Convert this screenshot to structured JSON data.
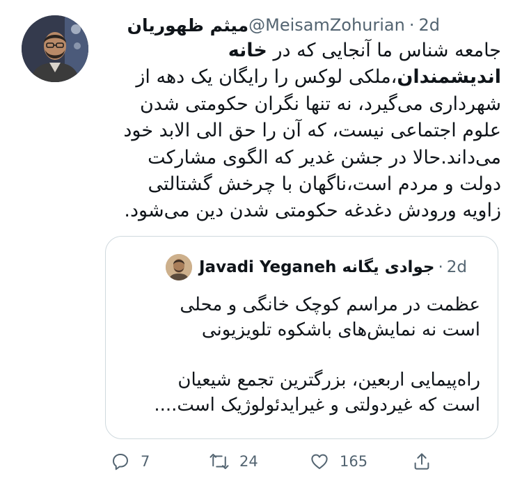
{
  "tweet": {
    "author_name": "میثم ظهوریان",
    "handle": "@MeisamZohurian",
    "separator": "·",
    "time": "2d",
    "text_bold_1": "خانه",
    "text_bold_2": "اندیشمندان",
    "text_lines": [
      "جامعه شناس ما آنجایی که در ",
      "،ملکی لوکس را رایگان یک دهه از",
      "شهرداری می‌گیرد، نه تنها نگران حکومتی شدن",
      "علوم اجتماعی نیست، که آن را حق الی الابد خود",
      "می‌داند.حالا در جشن غدیر که الگوی مشارکت",
      "دولت و مردم است،ناگهان با چرخش گشتالتی",
      "زاویه ورودش دغدغه حکومتی شدن دین می‌شود."
    ]
  },
  "quoted": {
    "author_name": "Javadi Yeganeh جوادی یگانه",
    "separator": "·",
    "time": "2d",
    "text_lines": [
      "عظمت در مراسم کوچک خانگی و محلی",
      "است نه نمایش‌های باشکوه تلویزیونی",
      "",
      "راه‌پیمایی اربعین، بزرگترین تجمع شیعیان",
      "است که غیردولتی و غیرایدئولوژیک است...."
    ]
  },
  "actions": {
    "reply_count": "7",
    "retweet_count": "24",
    "like_count": "165",
    "icons": [
      "reply-icon",
      "retweet-icon",
      "like-icon",
      "share-icon"
    ]
  },
  "colors": {
    "text": "#0f1419",
    "secondary": "#536471",
    "border": "#cfd9de"
  }
}
